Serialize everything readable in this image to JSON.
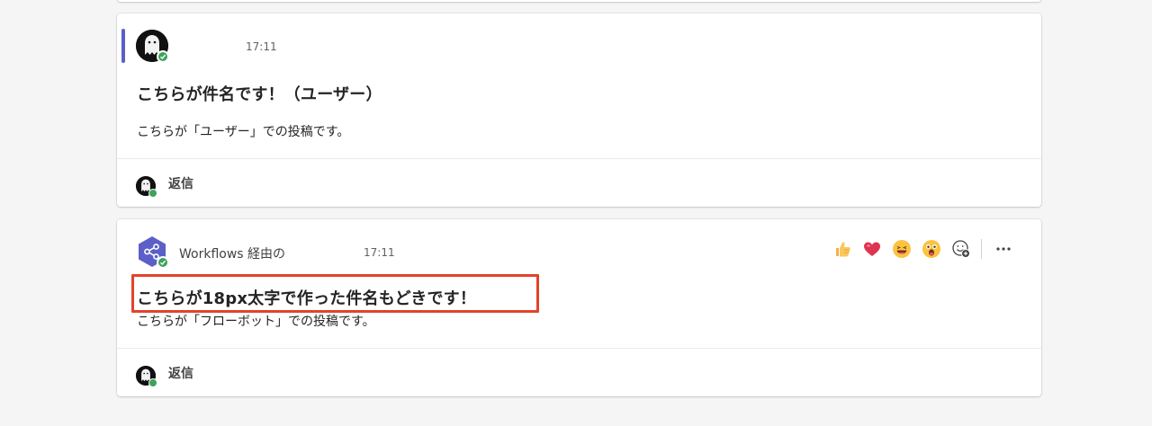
{
  "messages": [
    {
      "sender": "",
      "time": "17:11",
      "subject": "こちらが件名です！（ユーザー）",
      "body": "こちらが「ユーザー」での投稿です。",
      "reply_label": "返信"
    },
    {
      "sender": "Workflows 経由の",
      "time": "17:11",
      "subject": "こちらが18px太字で作った件名もどきです！",
      "body": "こちらが「フローボット」での投稿です。",
      "reply_label": "返信",
      "reactions": [
        "thumbs-up-icon",
        "heart-icon",
        "laughing-face-icon",
        "surprised-face-icon",
        "add-reaction-icon"
      ],
      "more_label": "…"
    }
  ],
  "colors": {
    "accent": "#5b5fc7",
    "presence": "#3ea35b",
    "highlight": "#e2432a",
    "workflow_avatar": "#5b5fc7"
  }
}
